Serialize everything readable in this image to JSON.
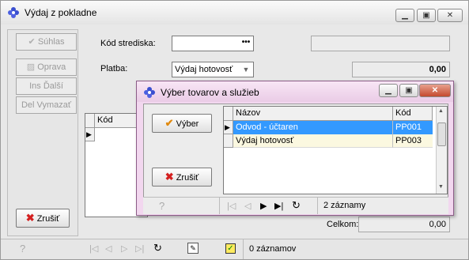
{
  "main": {
    "title": "Výdaj z pokladne",
    "buttons": {
      "suhlas": "Súhlas",
      "oprava": "Oprava",
      "ins": "Ins Ďalší",
      "del": "Del Vymazať",
      "zrusit": "Zrušiť"
    },
    "form": {
      "kod_strediska_label": "Kód strediska:",
      "kod_strediska_value": "",
      "platba_label": "Platba:",
      "platba_value": "Výdaj hotovosť",
      "amount": "0,00"
    },
    "grid": {
      "col_kod": "Kód"
    },
    "totals": {
      "label": "Celkom:",
      "value": "0,00"
    },
    "status": {
      "records": "0 záznamov",
      "help": "?"
    }
  },
  "dialog": {
    "title": "Výber tovarov a služieb",
    "buttons": {
      "vyber": "Výber",
      "zrusit": "Zrušiť"
    },
    "columns": {
      "nazov": "Názov",
      "kod": "Kód"
    },
    "rows": [
      {
        "nazov": "Odvod - účtaren",
        "kod": "PP001"
      },
      {
        "nazov": "Výdaj hotovosť",
        "kod": "PP003"
      }
    ],
    "status": {
      "records": "2 záznamy",
      "help": "?"
    }
  },
  "colors": {
    "selection": "#3399ff",
    "dialog_frame": "#f2d7ef",
    "close_button": "#c44a2e",
    "delete_icon": "#d42020",
    "check_icon": "#e08a10"
  }
}
